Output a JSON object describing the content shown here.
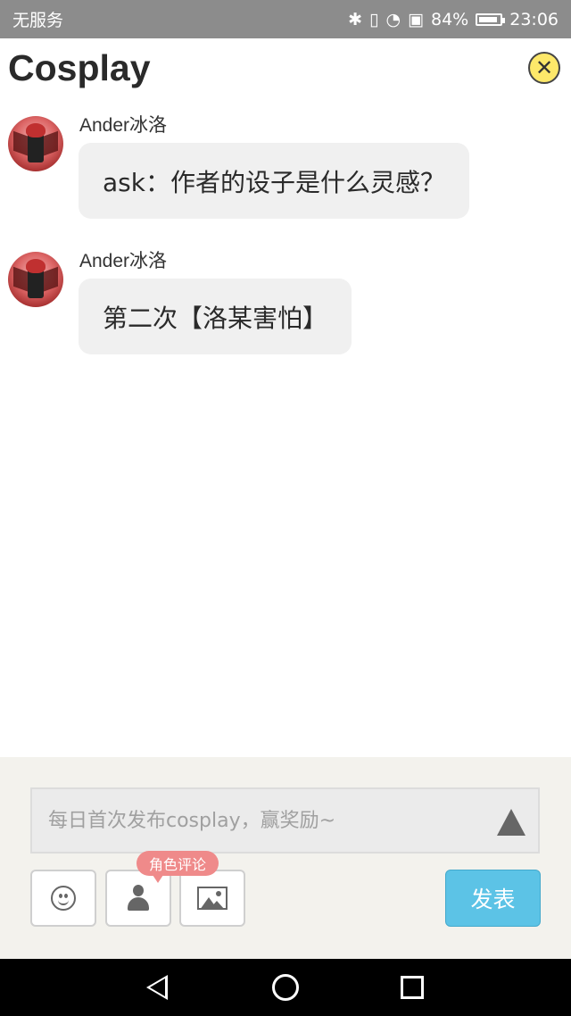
{
  "status_bar": {
    "carrier": "无服务",
    "battery_percent": "84%",
    "time": "23:06",
    "icons": [
      "bluetooth-icon",
      "vibrate-icon",
      "wifi-icon",
      "sim-icon",
      "battery-icon"
    ]
  },
  "header": {
    "title": "Cosplay",
    "close_icon": "close-icon"
  },
  "messages": [
    {
      "username": "Ander冰洛",
      "text": "ask：作者的设子是什么灵感？"
    },
    {
      "username": "Ander冰洛",
      "text": "第二次【洛某害怕】"
    }
  ],
  "composer": {
    "placeholder": "每日首次发布cosplay，赢奖励~",
    "role_tip": "角色评论",
    "send_label": "发表",
    "tools": [
      "smile-icon",
      "person-icon",
      "image-icon"
    ]
  },
  "colors": {
    "status_bar": "#8c8c8c",
    "bubble": "#f0f0f0",
    "send_button": "#5cc3e6",
    "role_tip": "#ef8a8a",
    "close_button": "#fde86a"
  }
}
